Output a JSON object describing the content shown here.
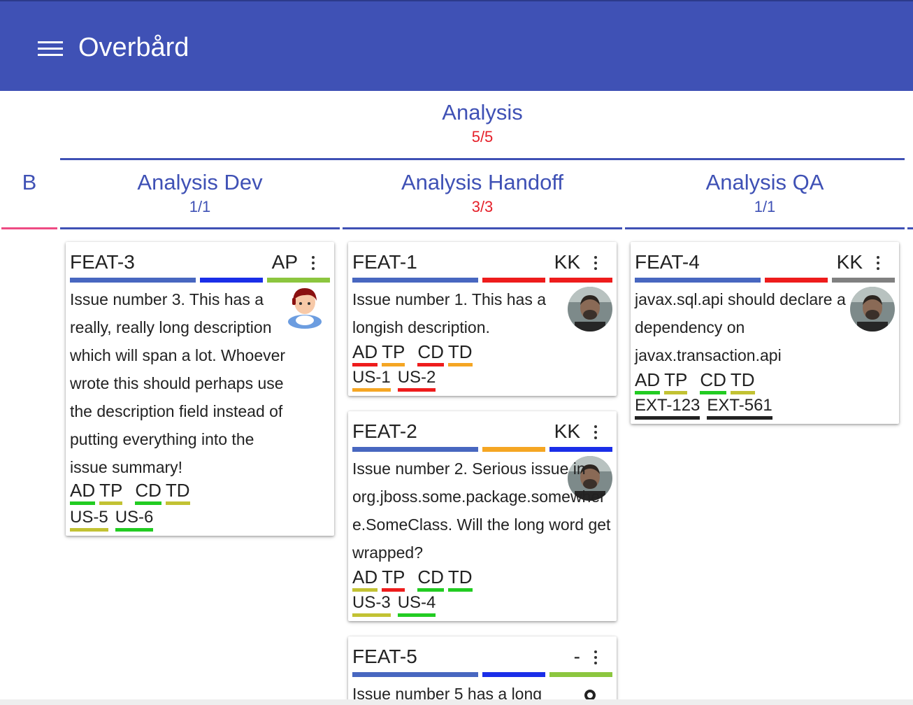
{
  "app": {
    "title": "Overbård"
  },
  "colors": {
    "primary": "#3f51b5",
    "over_limit": "#e5202a",
    "backlog_rule": "#ee4b83"
  },
  "board": {
    "backlog_label": "B",
    "parent": {
      "name": "Analysis",
      "count": "5/5"
    },
    "columns": [
      {
        "name": "Analysis Dev",
        "count": "1/1"
      },
      {
        "name": "Analysis Handoff",
        "count": "3/3"
      },
      {
        "name": "Analysis QA",
        "count": "1/1"
      }
    ]
  },
  "cards": {
    "feat3": {
      "id": "FEAT-3",
      "assignee": "AP",
      "bar_colors": [
        "#4867c0",
        "#1a2ee8",
        "#8cc63f"
      ],
      "description": "Issue number 3. This has a really, really long description which will span a lot. Whoever wrote this should perhaps use the description field instead of putting everything into the issue summary!",
      "tags": [
        "AD",
        "TP",
        "CD",
        "TD"
      ],
      "tag_colors": [
        "#22cc22",
        "#c2c233",
        "#22cc22",
        "#c2c233"
      ],
      "links": [
        "US-5",
        "US-6"
      ],
      "link_colors": [
        "#c2c233",
        "#22cc22"
      ],
      "avatar_icon": "cartoon-user-icon"
    },
    "feat1": {
      "id": "FEAT-1",
      "assignee": "KK",
      "bar_colors": [
        "#4867c0",
        "#ee1c1c",
        "#ee1c1c"
      ],
      "description": "Issue number 1. This has a longish description.",
      "tags": [
        "AD",
        "TP",
        "CD",
        "TD"
      ],
      "tag_colors": [
        "#ee1c1c",
        "#f5a623",
        "#ee1c1c",
        "#f5a623"
      ],
      "links": [
        "US-1",
        "US-2"
      ],
      "link_colors": [
        "#f5a623",
        "#ee1c1c"
      ],
      "avatar_icon": "photo-user-icon"
    },
    "feat2": {
      "id": "FEAT-2",
      "assignee": "KK",
      "bar_colors": [
        "#4867c0",
        "#f5a623",
        "#1a2ee8"
      ],
      "description": "Issue number 2. Serious issue in org.jboss.some.package.somewhere.SomeClass. Will the long word get wrapped?",
      "tags": [
        "AD",
        "TP",
        "CD",
        "TD"
      ],
      "tag_colors": [
        "#c2c233",
        "#ee1c1c",
        "#22cc22",
        "#22cc22"
      ],
      "links": [
        "US-3",
        "US-4"
      ],
      "link_colors": [
        "#c2c233",
        "#22cc22"
      ],
      "avatar_icon": "photo-user-icon"
    },
    "feat5": {
      "id": "FEAT-5",
      "assignee": "-",
      "bar_colors": [
        "#4867c0",
        "#1a2ee8",
        "#8cc63f"
      ],
      "description": "Issue number 5 has a long"
    },
    "feat4": {
      "id": "FEAT-4",
      "assignee": "KK",
      "bar_colors": [
        "#4867c0",
        "#ee1c1c",
        "#808080"
      ],
      "description": "javax.sql.api should declare a dependency on javax.transaction.api",
      "tags": [
        "AD",
        "TP",
        "CD",
        "TD"
      ],
      "tag_colors": [
        "#22cc22",
        "#c2c233",
        "#22cc22",
        "#c2c233"
      ],
      "links": [
        "EXT-123",
        "EXT-561"
      ],
      "link_colors": [
        "#222222",
        "#222222"
      ],
      "avatar_icon": "photo-user-icon"
    }
  }
}
